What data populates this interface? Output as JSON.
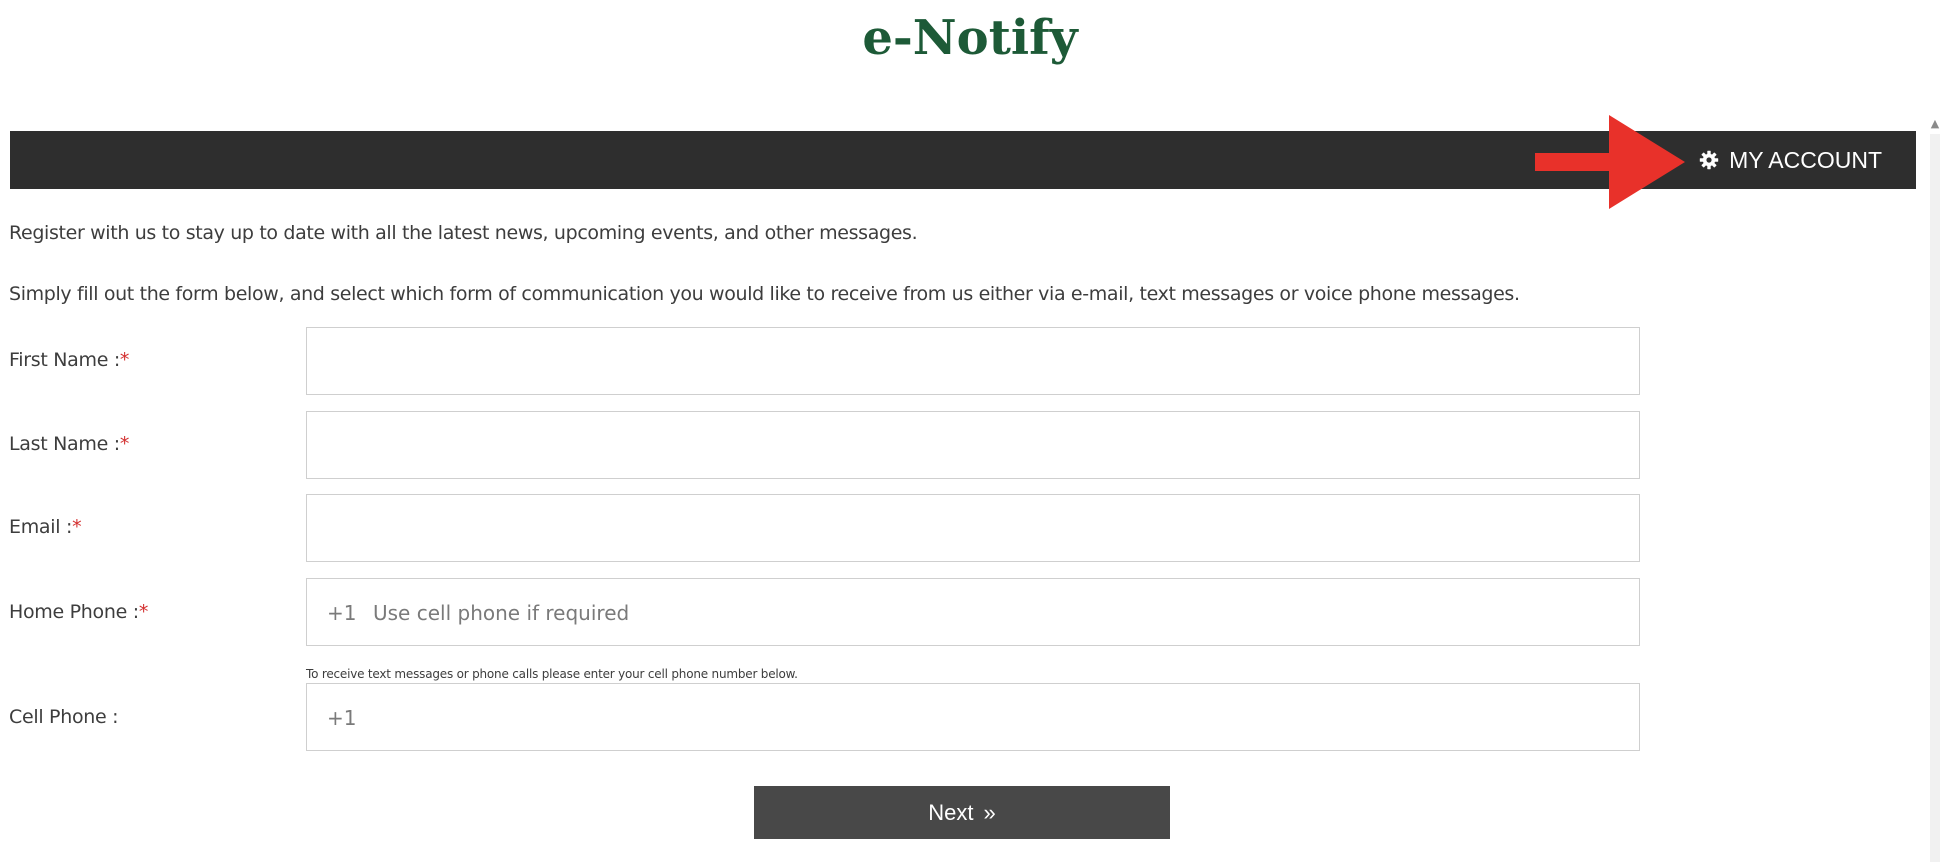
{
  "header": {
    "title": "e-Notify"
  },
  "nav": {
    "account_label": "MY ACCOUNT",
    "account_icon": "gear-icon",
    "bar_color": "#2e2e2e"
  },
  "annotation": {
    "arrow_color": "#e8312a"
  },
  "intro": {
    "line1": "Register with us to stay up to date with all the latest news, upcoming events, and other messages.",
    "line2": "Simply fill out the form below, and select which form of communication you would like to receive from us either via e-mail, text messages or voice phone messages."
  },
  "form": {
    "required_marker": "*",
    "first_name": {
      "label": "First Name :",
      "value": ""
    },
    "last_name": {
      "label": "Last Name :",
      "value": ""
    },
    "email": {
      "label": "Email :",
      "value": ""
    },
    "home_phone": {
      "label": "Home Phone :",
      "prefix": "+1",
      "placeholder": "Use cell phone if required"
    },
    "cell_hint": "To receive text messages or phone calls please enter your cell phone number below.",
    "cell_phone": {
      "label": "Cell Phone :",
      "prefix": "+1",
      "placeholder": ""
    },
    "next_label": "Next",
    "next_icon": "double-chevron-right-icon"
  },
  "colors": {
    "title_green": "#1d5a37",
    "required_red": "#d32f2f",
    "button_bg": "#484848"
  }
}
